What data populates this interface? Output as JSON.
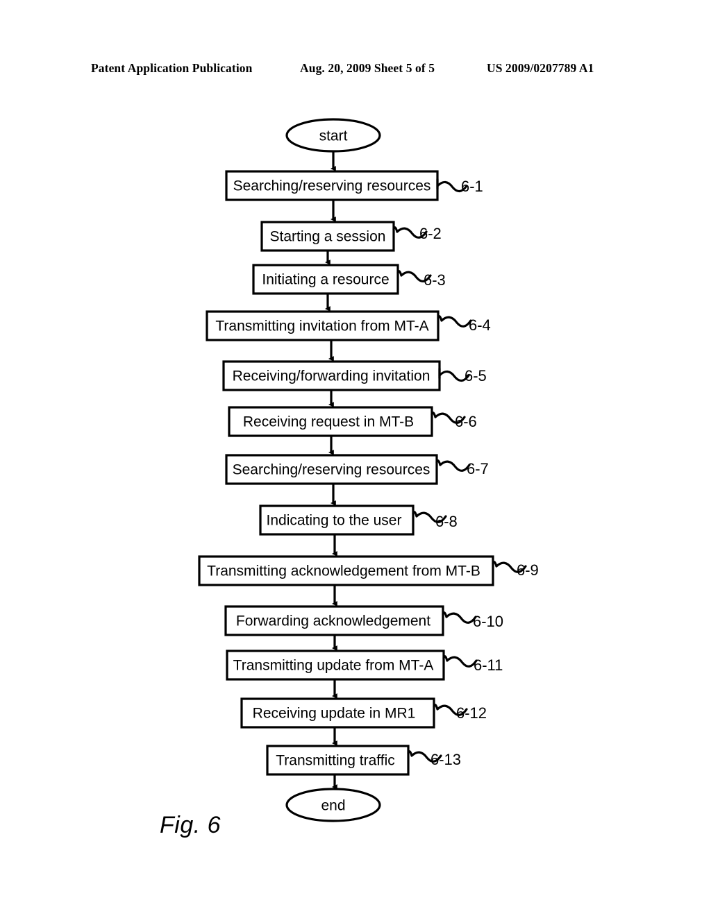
{
  "header": {
    "left": "Patent Application Publication",
    "middle": "Aug. 20, 2009  Sheet 5 of 5",
    "right": "US 2009/0207789 A1"
  },
  "figure": {
    "caption": "Fig. 6",
    "start_label": "start",
    "end_label": "end",
    "steps": [
      {
        "ref": "6-1",
        "label": "Searching/reserving resources"
      },
      {
        "ref": "6-2",
        "label": "Starting a session"
      },
      {
        "ref": "6-3",
        "label": "Initiating a resource"
      },
      {
        "ref": "6-4",
        "label": "Transmitting invitation from MT-A"
      },
      {
        "ref": "6-5",
        "label": "Receiving/forwarding invitation"
      },
      {
        "ref": "6-6",
        "label": "Receiving request in MT-B"
      },
      {
        "ref": "6-7",
        "label": "Searching/reserving resources"
      },
      {
        "ref": "6-8",
        "label": "Indicating to the user"
      },
      {
        "ref": "6-9",
        "label": "Transmitting acknowledgement from MT-B"
      },
      {
        "ref": "6-10",
        "label": "Forwarding acknowledgement"
      },
      {
        "ref": "6-11",
        "label": "Transmitting update from MT-A"
      },
      {
        "ref": "6-12",
        "label": "Receiving update in MR1"
      },
      {
        "ref": "6-13",
        "label": "Transmitting traffic"
      }
    ]
  },
  "colors": {
    "ink": "#000000",
    "paper": "#ffffff"
  }
}
